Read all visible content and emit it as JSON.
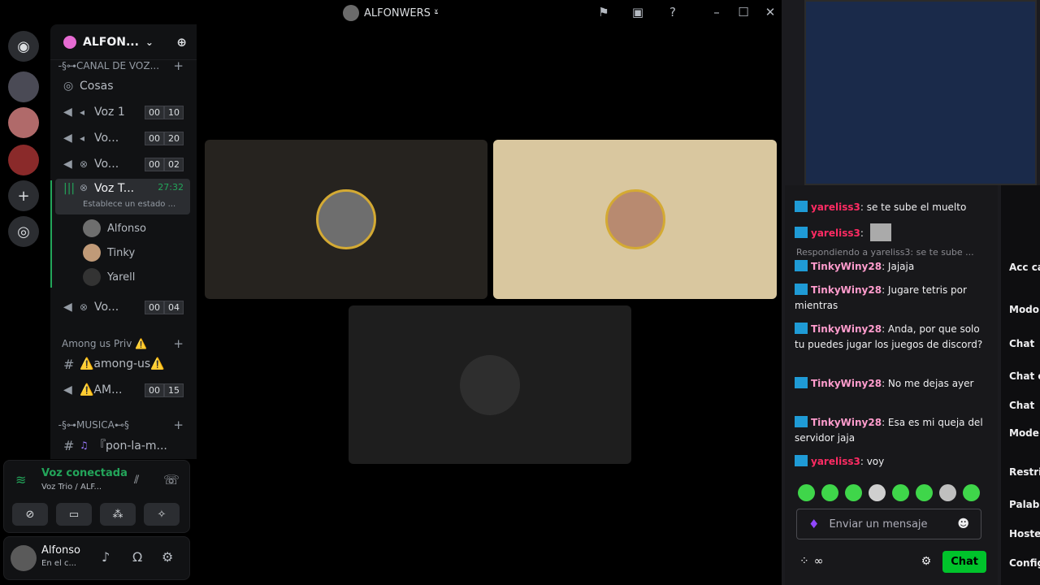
{
  "discord": {
    "window_title": "ALFONWERS ˠ̵",
    "server_name": "ALFON...",
    "categories": {
      "voz": "̵̵§⊶CANAL DE VOZ...",
      "among": "Among us Priv ⚠️",
      "musica": "̵§⊶MUSICA⊷§"
    },
    "channels": [
      {
        "name": "Cosas"
      },
      {
        "name": "Voz 1",
        "a": "00",
        "b": "10"
      },
      {
        "name": "Vo...",
        "a": "00",
        "b": "20"
      },
      {
        "name": "Vo...",
        "a": "00",
        "b": "02"
      },
      {
        "name": "Voz T...",
        "timer": "27:32",
        "status": "Establece un estado ..."
      },
      {
        "name": "Vo...",
        "a": "00",
        "b": "04"
      },
      {
        "name": "⚠️among-us⚠️"
      },
      {
        "name": "⚠️AM...",
        "a": "00",
        "b": "15"
      },
      {
        "name": "『pon-la-m..."
      }
    ],
    "members": [
      "Alfonso",
      "Tinky",
      "Yarell"
    ],
    "voice_panel": {
      "title": "Voz conectada",
      "subtitle": "Voz Trio / ALF..."
    },
    "user": {
      "name": "Alfonso",
      "status": "En el c..."
    }
  },
  "chat": {
    "messages": [
      {
        "user": "yareliss3",
        "text": ": se te sube el muelto"
      },
      {
        "user": "yareliss3",
        "text": ":"
      },
      {
        "user": "TinkyWiny28",
        "text": ": Jajaja"
      },
      {
        "user": "TinkyWiny28",
        "text": ": Jugare tetris por mientras"
      },
      {
        "user": "TinkyWiny28",
        "text": ": Anda, por que solo tu puedes jugar los juegos de discord?"
      },
      {
        "user": "TinkyWiny28",
        "text": ": No me dejas ayer"
      },
      {
        "user": "TinkyWiny28",
        "text": ": Esa es mi queja del servidor jaja"
      },
      {
        "user": "yareliss3",
        "text": ": voy"
      }
    ],
    "reply_preview": "Respondiendo a yareliss3: se te sube ...",
    "input_placeholder": "Enviar un mensaje",
    "send_label": "Chat",
    "points_label": "∞"
  },
  "side_menu": {
    "items": [
      "Acc car",
      "Modo",
      "Chat",
      "Chat c",
      "Chat",
      "Mode con IA",
      "Restri",
      "Palab",
      "Hoste",
      "Config"
    ]
  },
  "colors": {
    "voice_green": "#23a55a",
    "chat_yareliss": "#ff2b63",
    "chat_tinky": "#ff9ccd",
    "twitch_purple": "#9147ff",
    "send_green": "#00c32b"
  }
}
